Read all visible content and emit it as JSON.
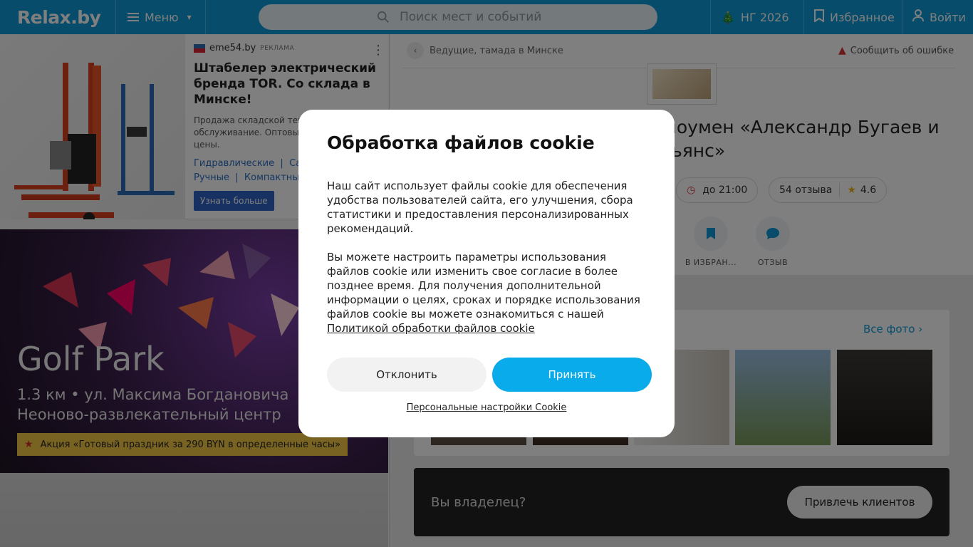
{
  "header": {
    "logo": "Relax.by",
    "menu_label": "Меню",
    "search_placeholder": "Поиск мест и событий",
    "ng_label": "НГ 2026",
    "favorites_label": "Избранное",
    "login_label": "Войти"
  },
  "ad": {
    "source": "eme54.by",
    "label": "РЕКЛАМА",
    "title": "Штабелер электрический бренда TOR. Со склада в Минске!",
    "description": "Продажа складской техн... обслуживание. Оптовые... цены.",
    "desc_line1": "Продажа складской техн",
    "desc_line2": "обслуживание. Оптовые",
    "desc_line3": "цены.",
    "links_line1": [
      "Гидравлические",
      "Сам"
    ],
    "links_line2": [
      "Ручные",
      "Компактные"
    ],
    "button": "Узнать больше"
  },
  "promo": {
    "title": "Golf Park",
    "distance_address": "1.3 км • ул. Максима Богдановича",
    "category": "Неоново-развлекательный центр",
    "badge": "Акция «Готовый праздник за 290 BYN в определенные часы»"
  },
  "main": {
    "breadcrumb": "Ведущие, тамада в Минске",
    "report": "Сообщить об ошибке",
    "title_line1": "шоумен «Александр Бугаев и",
    "title_line2": "льянс»",
    "hours": "до 21:00",
    "reviews": "54 отзыва",
    "rating": "4.6",
    "action_fav": "В ИЗБРАН...",
    "action_review": "ОТЗЫВ",
    "all_photos": "Все фото",
    "owner_question": "Вы владелец?",
    "owner_button": "Привлечь клиентов"
  },
  "cookie": {
    "title": "Обработка файлов cookie",
    "para1": "Наш сайт использует файлы cookie для обеспечения удобства пользователей сайта, его улучшения, сбора статистики и предоставления персонализированных рекомендаций.",
    "para2": "Вы можете настроить параметры использования файлов cookie или изменить свое согласие в более позднее время. Для получения дополнительной информации о целях, сроках и порядке использования файлов cookie вы можете ознакомиться с нашей",
    "policy_link": "Политикой обработки файлов cookie",
    "decline": "Отклонить",
    "accept": "Принять",
    "personal": "Персональные настройки Cookie"
  },
  "colors": {
    "brand": "#0e9ad7",
    "accept": "#0aabeb",
    "promo_badge": "#f2c744"
  }
}
